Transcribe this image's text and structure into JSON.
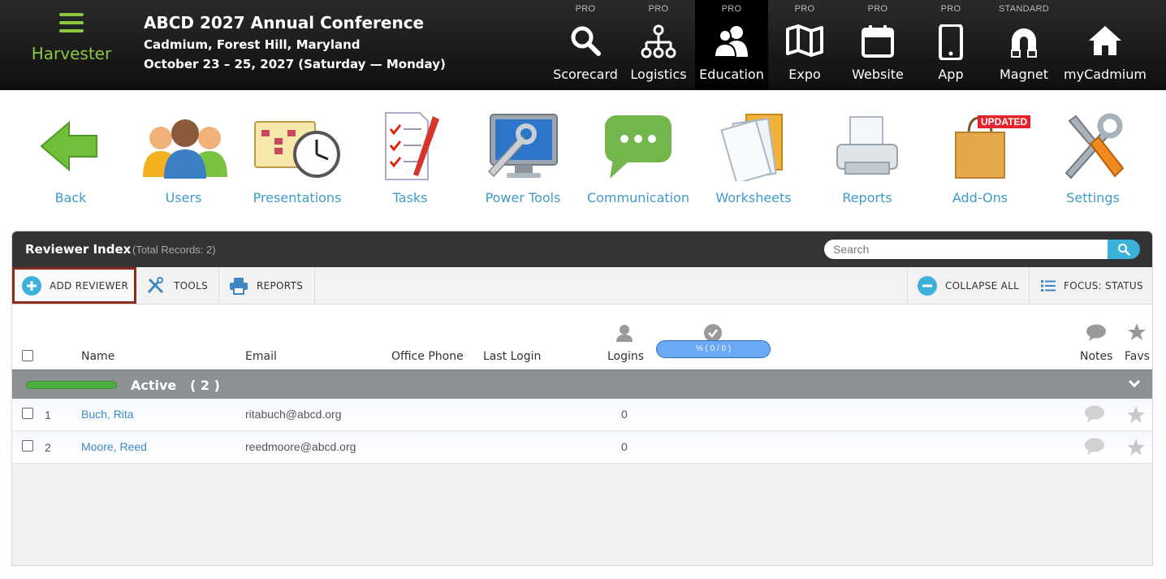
{
  "brand": {
    "name": "Harvester"
  },
  "conference": {
    "title": "ABCD 2027 Annual Conference",
    "location": "Cadmium, Forest Hill, Maryland",
    "dates": "October 23 – 25, 2027 (Saturday — Monday)"
  },
  "modules": [
    {
      "tier": "PRO",
      "label": "Scorecard",
      "icon": "search-icon"
    },
    {
      "tier": "PRO",
      "label": "Logistics",
      "icon": "hierarchy-icon"
    },
    {
      "tier": "PRO",
      "label": "Education",
      "icon": "people-icon",
      "active": true
    },
    {
      "tier": "PRO",
      "label": "Expo",
      "icon": "map-icon"
    },
    {
      "tier": "PRO",
      "label": "Website",
      "icon": "calendar-icon"
    },
    {
      "tier": "PRO",
      "label": "App",
      "icon": "phone-icon"
    },
    {
      "tier": "STANDARD",
      "label": "Magnet",
      "icon": "magnet-icon"
    },
    {
      "tier": "",
      "label": "myCadmium",
      "icon": "home-icon"
    }
  ],
  "tools": [
    {
      "label": "Back",
      "icon": "back-arrow-icon"
    },
    {
      "label": "Users",
      "icon": "users-icon"
    },
    {
      "label": "Presentations",
      "icon": "calendar-clock-icon"
    },
    {
      "label": "Tasks",
      "icon": "checklist-icon"
    },
    {
      "label": "Power Tools",
      "icon": "monitor-wrench-icon"
    },
    {
      "label": "Communication",
      "icon": "chat-bubble-icon"
    },
    {
      "label": "Worksheets",
      "icon": "documents-icon"
    },
    {
      "label": "Reports",
      "icon": "printer-icon"
    },
    {
      "label": "Add-Ons",
      "icon": "shopping-bag-icon",
      "badge": "UPDATED"
    },
    {
      "label": "Settings",
      "icon": "tools-icon"
    }
  ],
  "panel": {
    "title": "Reviewer Index",
    "count": "(Total Records: 2)",
    "search_placeholder": "Search"
  },
  "actions": {
    "add_reviewer": "ADD REVIEWER",
    "tools": "TOOLS",
    "reports": "REPORTS",
    "collapse_all": "COLLAPSE ALL",
    "focus_status": "FOCUS: STATUS"
  },
  "columns": {
    "name": "Name",
    "email": "Email",
    "office_phone": "Office Phone",
    "last_login": "Last Login",
    "logins": "Logins",
    "progress": "% ( 0 / 0 )",
    "notes": "Notes",
    "favs": "Favs"
  },
  "group": {
    "label": "Active",
    "count": "( 2 )"
  },
  "rows": [
    {
      "num": "1",
      "name": "Buch, Rita",
      "email": "ritabuch@abcd.org",
      "logins": "0"
    },
    {
      "num": "2",
      "name": "Moore, Reed",
      "email": "reedmoore@abcd.org",
      "logins": "0"
    }
  ],
  "colors": {
    "accent": "#3f9bc7",
    "brand_green": "#8dc63f",
    "highlight": "#8b2a1f",
    "status_green": "#4caf3f"
  }
}
